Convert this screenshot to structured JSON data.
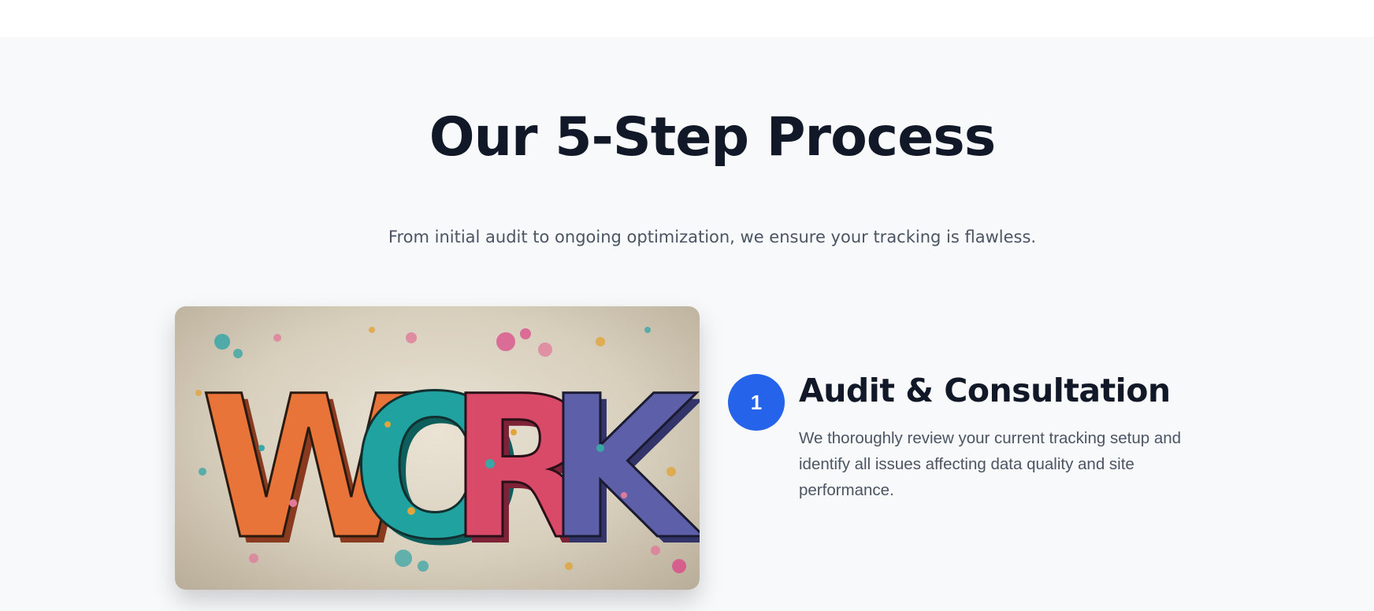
{
  "section": {
    "title": "Our 5-Step Process",
    "subtitle": "From initial audit to ongoing optimization, we ensure your tracking is flawless."
  },
  "hero_image": {
    "word": "WORK",
    "letters": [
      "W",
      "O",
      "R",
      "K"
    ],
    "letter_colors": [
      "#e8743a",
      "#1fa2a0",
      "#d94a68",
      "#5d5fa8"
    ]
  },
  "steps": [
    {
      "number": "1",
      "title": "Audit & Consultation",
      "description": "We thoroughly review your current tracking setup and identify all issues affecting data quality and site performance."
    }
  ],
  "colors": {
    "accent": "#2563eb",
    "heading": "#111827",
    "body_text": "#4b5563",
    "section_bg": "#f8f9fb"
  }
}
